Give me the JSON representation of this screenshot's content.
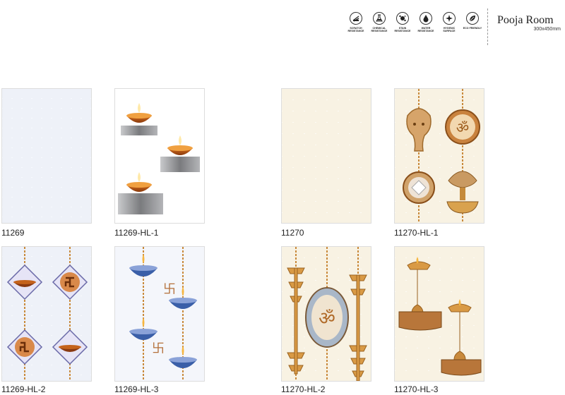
{
  "header": {
    "title": "Pooja Room",
    "size": "300x450mm",
    "features": [
      {
        "icon": "scratch-resistance-icon",
        "label": "SCRATCH RESISTANCE"
      },
      {
        "icon": "chemical-resistance-icon",
        "label": "CHEMICAL RESISTANCE"
      },
      {
        "icon": "stain-resistance-icon",
        "label": "STAIN RESISTANCE"
      },
      {
        "icon": "water-resistance-icon",
        "label": "WATER RESISTANCE"
      },
      {
        "icon": "hygienic-surface-icon",
        "label": "HYGENIC SURFACE"
      },
      {
        "icon": "eco-friendly-icon",
        "label": "ECO FRIENDLY"
      }
    ]
  },
  "tiles": [
    {
      "code": "11269"
    },
    {
      "code": "11269-HL-1"
    },
    {
      "code": "11270"
    },
    {
      "code": "11270-HL-1"
    },
    {
      "code": "11269-HL-2"
    },
    {
      "code": "11269-HL-3"
    },
    {
      "code": "11270-HL-2"
    },
    {
      "code": "11270-HL-3"
    }
  ],
  "colors": {
    "blue_tile": "#eef1f8",
    "cream_tile": "#f8f2e3",
    "gold": "#d19a4f",
    "copper": "#b8622a"
  }
}
